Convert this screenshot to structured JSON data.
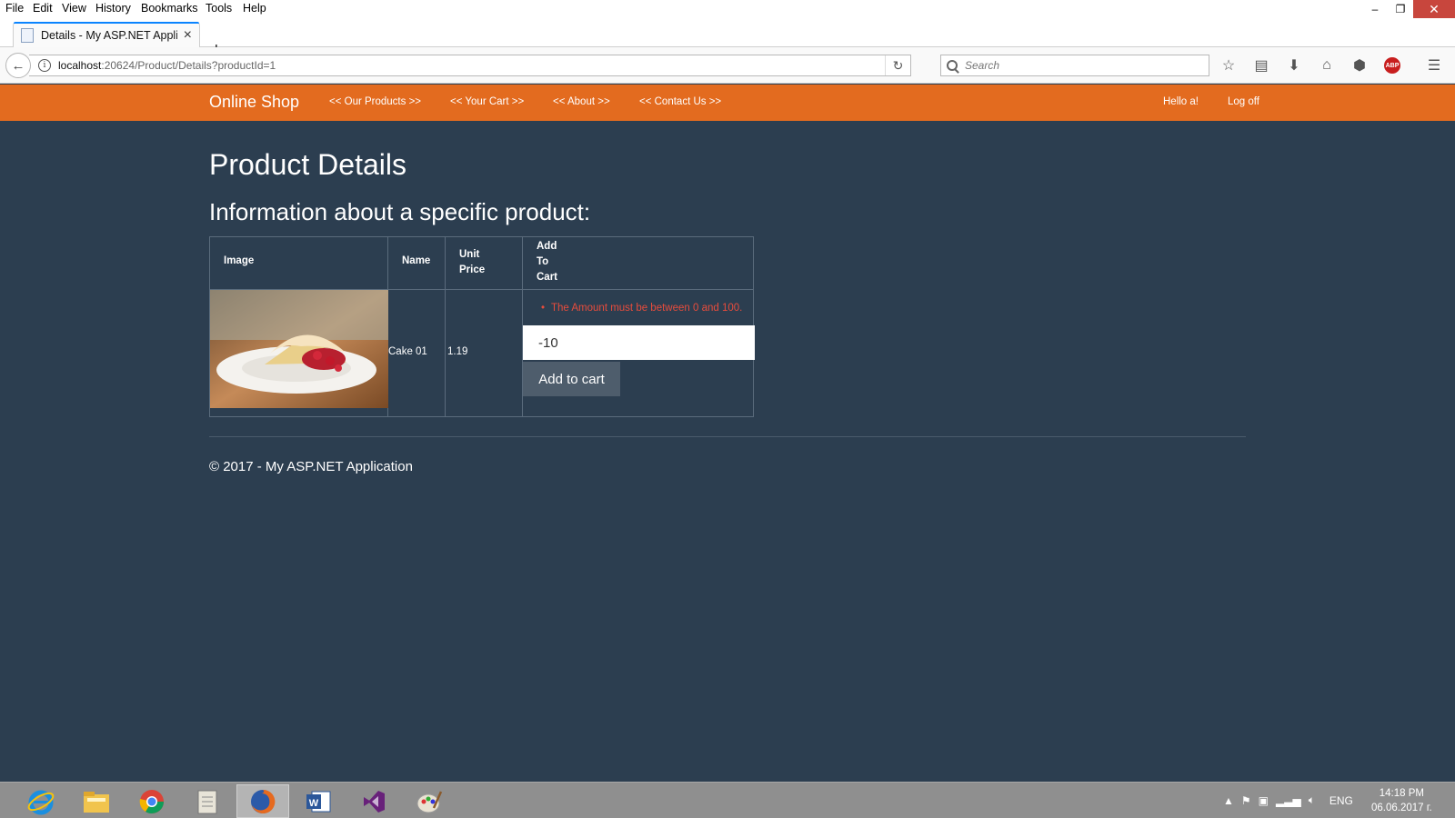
{
  "browser": {
    "menu": [
      "File",
      "Edit",
      "View",
      "History",
      "Bookmarks",
      "Tools",
      "Help"
    ],
    "tab_title": "Details - My ASP.NET Applic",
    "url_host": "localhost",
    "url_rest": ":20624/Product/Details?productId=1",
    "search_placeholder": "Search",
    "abp_label": "ABP",
    "window_controls": {
      "minimize": "–",
      "restore": "❐",
      "close": "✕"
    }
  },
  "site": {
    "brand": "Online Shop",
    "nav": [
      "<< Our Products >>",
      "<< Your Cart >>",
      "<< About >>",
      "<< Contact Us >>"
    ],
    "greeting": "Hello a!",
    "logoff": "Log off"
  },
  "page": {
    "title": "Product Details",
    "subtitle": "Information about a specific product:",
    "table": {
      "headers": {
        "image": "Image",
        "name": "Name",
        "unit_price": "Unit Price",
        "add_to_cart": "Add To Cart"
      },
      "header_lines": {
        "unit_price": [
          "Unit",
          "Price"
        ],
        "add_to_cart": [
          "Add",
          "To",
          "Cart"
        ]
      },
      "row": {
        "name": "Cake 01",
        "unit_price": "1.19"
      }
    },
    "validation_message": "The Amount must be between 0 and 100.",
    "amount_value": "-10",
    "add_button": "Add to cart",
    "footer": "© 2017 - My ASP.NET Application"
  },
  "taskbar": {
    "apps": [
      "internet-explorer-icon",
      "file-explorer-icon",
      "chrome-icon",
      "notepad-icon",
      "firefox-icon",
      "word-icon",
      "visual-studio-icon",
      "paint-icon"
    ],
    "language": "ENG",
    "time": "14:18 PM",
    "date": "06.06.2017 г."
  },
  "colors": {
    "page_bg": "#2c3e50",
    "navbar": "#e36b1f",
    "error": "#e74c3c",
    "button": "#4e5d6c"
  }
}
